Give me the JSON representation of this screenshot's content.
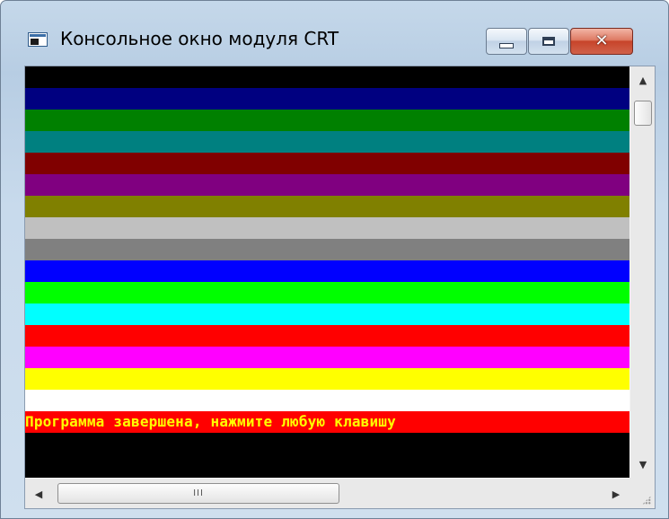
{
  "window": {
    "title": "Консольное окно модуля CRT",
    "icon": "console-window-icon",
    "controls": {
      "minimize_icon": "minimize-icon",
      "maximize_icon": "maximize-icon",
      "close_icon": "close-icon",
      "close_glyph": "✕"
    }
  },
  "console": {
    "background": "#000000",
    "bands": [
      {
        "name": "black",
        "color": "#000000"
      },
      {
        "name": "blue",
        "color": "#000080"
      },
      {
        "name": "green",
        "color": "#008000"
      },
      {
        "name": "cyan",
        "color": "#008080"
      },
      {
        "name": "red",
        "color": "#800000"
      },
      {
        "name": "magenta",
        "color": "#800080"
      },
      {
        "name": "brown",
        "color": "#808000"
      },
      {
        "name": "lightgray",
        "color": "#c0c0c0"
      },
      {
        "name": "darkgray",
        "color": "#808080"
      },
      {
        "name": "lightblue",
        "color": "#0000ff"
      },
      {
        "name": "lightgreen",
        "color": "#00ff00"
      },
      {
        "name": "lightcyan",
        "color": "#00ffff"
      },
      {
        "name": "lightred",
        "color": "#ff0000"
      },
      {
        "name": "lightmagenta",
        "color": "#ff00ff"
      },
      {
        "name": "yellow",
        "color": "#ffff00"
      },
      {
        "name": "white",
        "color": "#ffffff"
      }
    ],
    "message": {
      "text": "Программа завершена, нажмите любую клавишу",
      "text_color": "#ffff00",
      "background": "#ff0000"
    }
  },
  "scrollbars": {
    "vertical": {
      "up_icon": "scroll-up-arrow-icon",
      "down_icon": "scroll-down-arrow-icon",
      "up_glyph": "▲",
      "down_glyph": "▼"
    },
    "horizontal": {
      "left_icon": "scroll-left-arrow-icon",
      "right_icon": "scroll-right-arrow-icon",
      "left_glyph": "◀",
      "right_glyph": "▶",
      "thumb_grip": "III"
    },
    "size_grip_icon": "resize-grip-icon"
  }
}
